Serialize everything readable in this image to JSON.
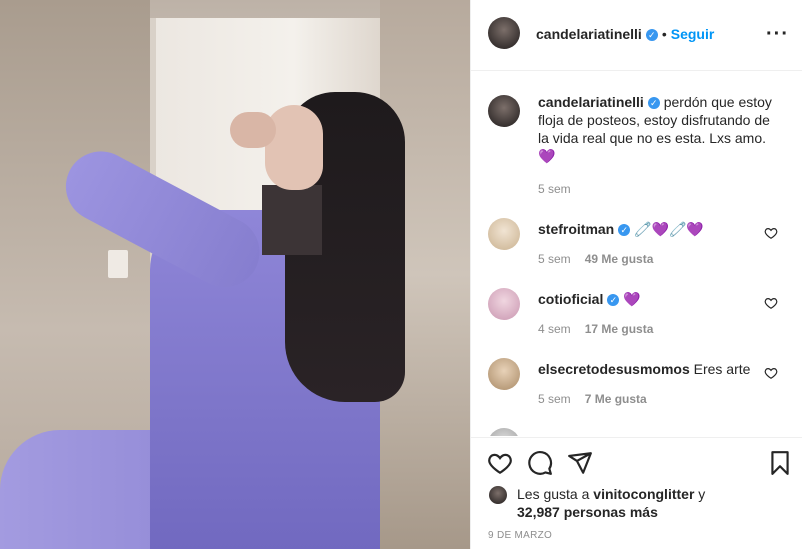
{
  "post": {
    "author": "candelariatinelli",
    "follow_label": "Seguir",
    "separator": "•",
    "more_icon": "more-horizontal-icon"
  },
  "caption": {
    "author": "candelariatinelli",
    "text": "perdón que estoy floja de posteos, estoy disfrutando de la vida real que no es esta. Lxs amo.",
    "emoji": "💜",
    "time": "5 sem"
  },
  "comments": [
    {
      "author": "stefroitman",
      "text": "🧷💜🧷💜",
      "time": "5 sem",
      "likes": "49 Me gusta",
      "verified": true
    },
    {
      "author": "cotioficial",
      "text": "💜",
      "time": "4 sem",
      "likes": "17 Me gusta",
      "verified": true
    },
    {
      "author": "elsecretodesusmomos",
      "text": "Eres arte",
      "time": "5 sem",
      "likes": "7 Me gusta",
      "verified": false
    }
  ],
  "likes": {
    "prefix": "Les gusta a",
    "user": "vinitoconglitter",
    "conj": "y",
    "count": "32,987 personas más"
  },
  "date": "9 DE MARZO",
  "colors": {
    "accent": "#0095f6",
    "verified": "#3897f0",
    "muted": "#8e8e8e"
  }
}
